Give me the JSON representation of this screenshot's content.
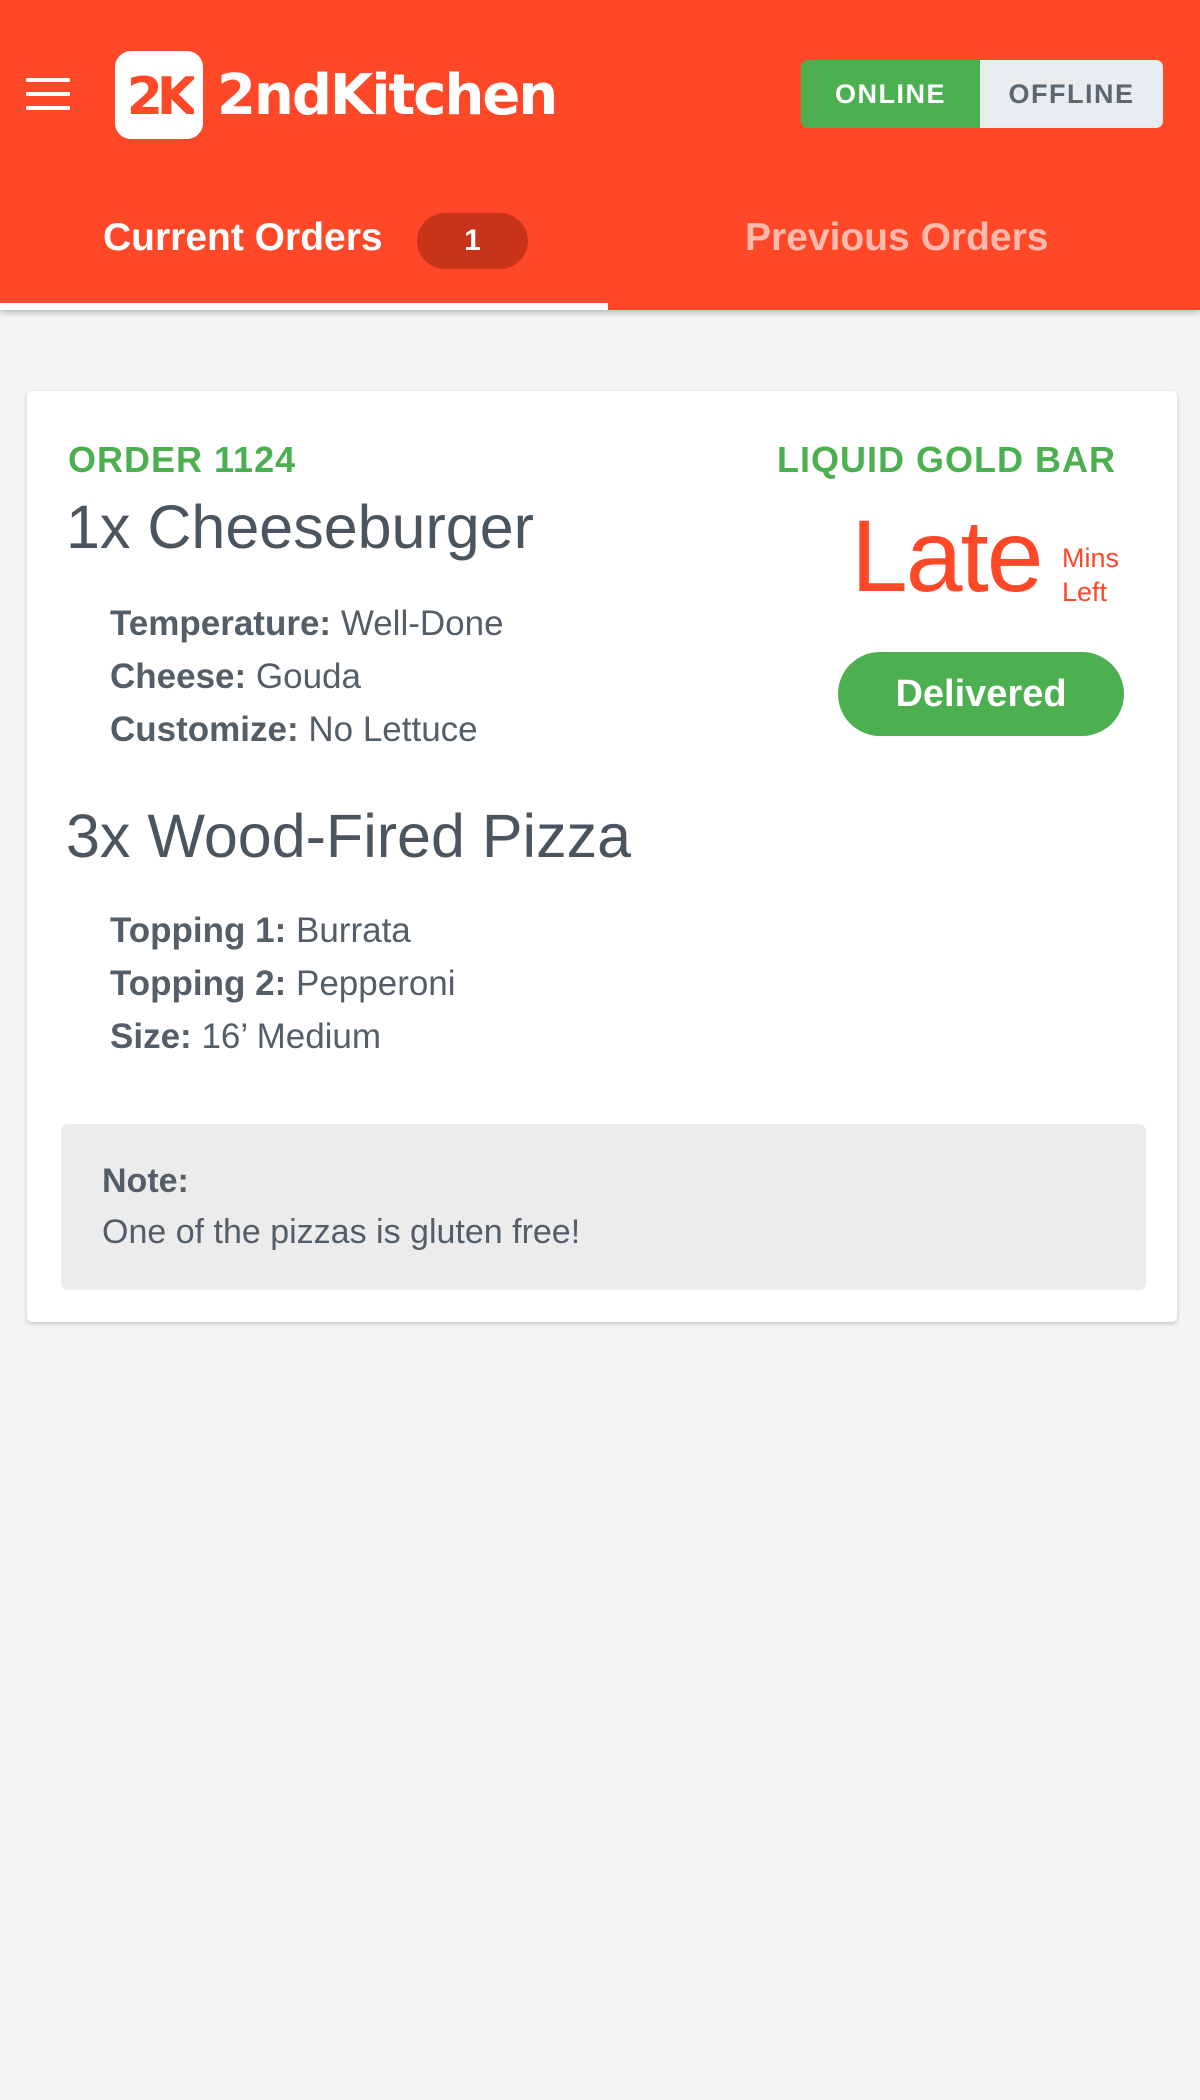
{
  "header": {
    "brand": "2ndKitchen",
    "logo_mark": "2K",
    "menu_icon": "hamburger-menu-icon",
    "accent_color": "#ff4828",
    "status_toggle": {
      "online_label": "ONLINE",
      "offline_label": "OFFLINE",
      "selected": "ONLINE"
    },
    "tabs": [
      {
        "label": "Current Orders",
        "badge": "1",
        "active": true
      },
      {
        "label": "Previous Orders",
        "active": false
      }
    ]
  },
  "order": {
    "id_label": "ORDER 1124",
    "venue": "LIQUID GOLD BAR",
    "time_status": "Late",
    "time_unit_line1": "Mins",
    "time_unit_line2": "Left",
    "action_label": "Delivered",
    "items": [
      {
        "title": "1x Cheeseburger",
        "modifiers": [
          {
            "name": "Temperature:",
            "value": "Well-Done"
          },
          {
            "name": "Cheese:",
            "value": "Gouda"
          },
          {
            "name": "Customize:",
            "value": "No Lettuce"
          }
        ]
      },
      {
        "title": "3x Wood-Fired Pizza",
        "modifiers": [
          {
            "name": "Topping 1:",
            "value": "Burrata"
          },
          {
            "name": "Topping 2:",
            "value": "Pepperoni"
          },
          {
            "name": "Size:",
            "value": "16’ Medium"
          }
        ]
      }
    ],
    "note_label": "Note:",
    "note_text": "One of the pizzas is gluten free!"
  },
  "colors": {
    "brand": "#ff4828",
    "success": "#4caf50",
    "text": "#4a5560"
  }
}
